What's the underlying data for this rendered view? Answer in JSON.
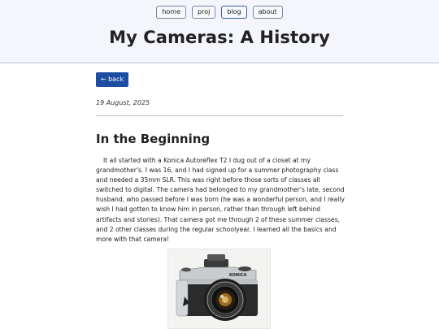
{
  "nav": {
    "items": [
      "home",
      "proj",
      "blog",
      "about"
    ]
  },
  "site": {
    "title": "My Cameras: A History"
  },
  "back_button": "← back",
  "post": {
    "date": "19 August, 2025",
    "section_title": "In the Beginning",
    "paragraph": "It all started with a Konica Autoreflex T2 I dug out of a closet at my grandmother's. I was 16, and I had signed up for a summer photography class and needed a 35mm SLR. This was right before those sorts of classes all switched to digital. The camera had belonged to my grandmother's late, second husband, who passed before I was born (he was a wonderful person, and I really wish I had gotten to know him in person, rather than through left behind artifacts and stories). That camera got me through 2 of these summer classes, and 2 other classes during the regular schoolyear. I learned all the basics and more with that camera!",
    "image": {
      "icon": "camera-photo",
      "brand_text": "KONICA"
    }
  },
  "colors": {
    "accent": "#1d4da3",
    "header_bg": "#f4f6fb",
    "border": "#b9bfcc"
  }
}
